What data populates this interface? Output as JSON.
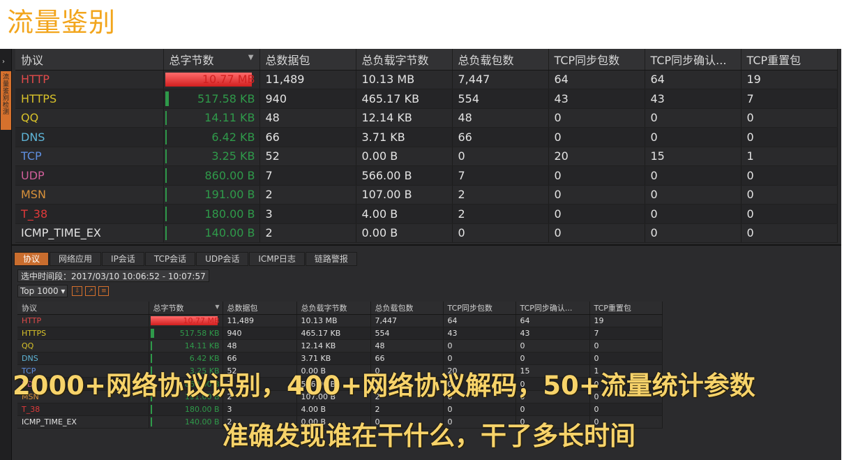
{
  "page_title": "流量鉴别",
  "side": {
    "arrow": "›",
    "tab_label": "流量鉴别检测"
  },
  "columns": [
    "协议",
    "总字节数",
    "总数据包",
    "总负载字节数",
    "总负载包数",
    "TCP同步包数",
    "TCP同步确认...",
    "TCP重置包"
  ],
  "colors": {
    "HTTP": "#e04a4a",
    "HTTPS": "#d8c22a",
    "QQ": "#d8c22a",
    "DNS": "#5fb6d8",
    "TCP": "#5f8fe0",
    "UDP": "#d05f9a",
    "MSN": "#d8913a",
    "T_38": "#e03a3a",
    "ICMP_TIME_EX": "#e4e4e4"
  },
  "rows": [
    {
      "proto": "HTTP",
      "bytes": "10.77 MB",
      "bar": 1.0,
      "packets": "11,489",
      "payload_bytes": "10.13 MB",
      "payload_packets": "7,447",
      "syn": "64",
      "synack": "64",
      "rst": "19"
    },
    {
      "proto": "HTTPS",
      "bytes": "517.58 KB",
      "bar": 0.047,
      "packets": "940",
      "payload_bytes": "465.17 KB",
      "payload_packets": "554",
      "syn": "43",
      "synack": "43",
      "rst": "7"
    },
    {
      "proto": "QQ",
      "bytes": "14.11 KB",
      "bar": 0.0013,
      "packets": "48",
      "payload_bytes": "12.14 KB",
      "payload_packets": "48",
      "syn": "0",
      "synack": "0",
      "rst": "0"
    },
    {
      "proto": "DNS",
      "bytes": "6.42 KB",
      "bar": 0.0006,
      "packets": "66",
      "payload_bytes": "3.71 KB",
      "payload_packets": "66",
      "syn": "0",
      "synack": "0",
      "rst": "0"
    },
    {
      "proto": "TCP",
      "bytes": "3.25 KB",
      "bar": 0.0003,
      "packets": "52",
      "payload_bytes": "0.00 B",
      "payload_packets": "0",
      "syn": "20",
      "synack": "15",
      "rst": "1"
    },
    {
      "proto": "UDP",
      "bytes": "860.00 B",
      "bar": 0.0001,
      "packets": "7",
      "payload_bytes": "566.00 B",
      "payload_packets": "7",
      "syn": "0",
      "synack": "0",
      "rst": "0"
    },
    {
      "proto": "MSN",
      "bytes": "191.00 B",
      "bar": 0.0,
      "packets": "2",
      "payload_bytes": "107.00 B",
      "payload_packets": "2",
      "syn": "0",
      "synack": "0",
      "rst": "0"
    },
    {
      "proto": "T_38",
      "bytes": "180.00 B",
      "bar": 0.0,
      "packets": "3",
      "payload_bytes": "4.00 B",
      "payload_packets": "2",
      "syn": "0",
      "synack": "0",
      "rst": "0"
    },
    {
      "proto": "ICMP_TIME_EX",
      "bytes": "140.00 B",
      "bar": 0.0,
      "packets": "2",
      "payload_bytes": "0.00 B",
      "payload_packets": "0",
      "syn": "0",
      "synack": "0",
      "rst": "0"
    }
  ],
  "tabs": [
    "协议",
    "网络应用",
    "IP会话",
    "TCP会话",
    "UDP会话",
    "ICMP日志",
    "链路警报"
  ],
  "time_range": "选中时间段：2017/03/10  10:06:52 - 10:07:57",
  "toolbar": {
    "top_select": "Top 1000",
    "icons": [
      "export-icon",
      "open-icon",
      "settings-icon"
    ]
  },
  "caption": {
    "line1": "2000+网络协议识别，400+网络协议解码，50+流量统计参数",
    "line2": "准确发现谁在干什么，干了多长时间"
  }
}
